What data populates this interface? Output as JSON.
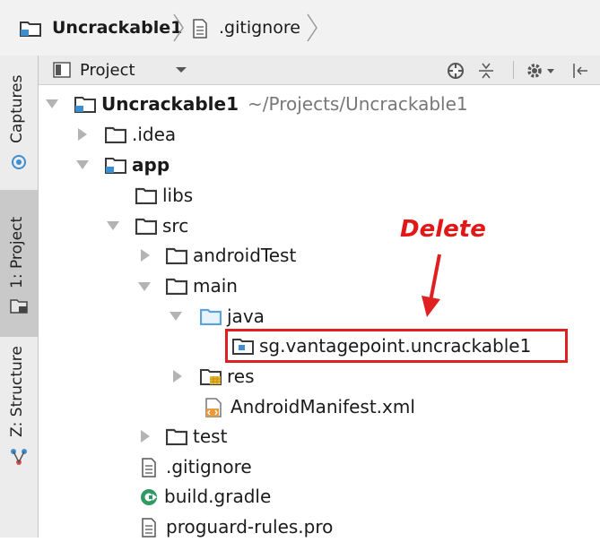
{
  "breadcrumb": {
    "project": "Uncrackable1",
    "file": ".gitignore"
  },
  "left_toolbar": {
    "captures": "Captures",
    "project": "1: Project",
    "structure": "Z: Structure"
  },
  "panel": {
    "view_label": "Project"
  },
  "tree": {
    "root_name": "Uncrackable1",
    "root_path": "~/Projects/Uncrackable1",
    "idea": ".idea",
    "app": "app",
    "libs": "libs",
    "src": "src",
    "android_test": "androidTest",
    "main": "main",
    "java": "java",
    "package": "sg.vantagepoint.uncrackable1",
    "res": "res",
    "manifest": "AndroidManifest.xml",
    "test": "test",
    "gitignore": ".gitignore",
    "build_gradle": "build.gradle",
    "proguard": "proguard-rules.pro"
  },
  "annotation": {
    "label": "Delete",
    "color": "#e02020"
  },
  "colors": {
    "folder": "#3a3a3a",
    "module_blue": "#3d8fd1",
    "java_folder": "#5aa3dc",
    "res_yellow": "#e8b930",
    "gradle_green": "#2f9a63"
  },
  "icons": [
    "folder-icon",
    "module-folder-icon",
    "java-folder-icon",
    "package-icon",
    "res-folder-icon",
    "xml-file-icon",
    "text-file-icon",
    "gradle-icon",
    "target-icon",
    "collapse-icon",
    "gear-icon",
    "hide-icon"
  ]
}
